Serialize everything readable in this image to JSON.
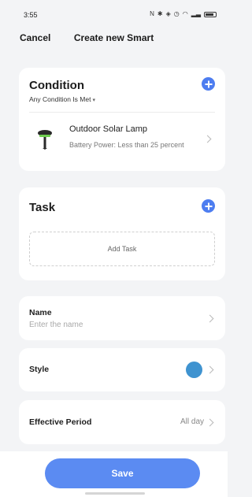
{
  "status_bar": {
    "time": "3:55",
    "icons": [
      "nfc-icon",
      "bluetooth-icon",
      "vibrate-icon",
      "alarm-icon",
      "wifi-icon",
      "signal-icon",
      "battery-icon"
    ]
  },
  "header": {
    "cancel_label": "Cancel",
    "title": "Create new Smart"
  },
  "condition": {
    "title": "Condition",
    "mode": "Any Condition Is Met",
    "caret": "▾",
    "device": {
      "name": "Outdoor Solar Lamp",
      "detail": "Battery Power: Less than 25 percent"
    }
  },
  "task": {
    "title": "Task",
    "add_label": "Add Task"
  },
  "name_field": {
    "label": "Name",
    "placeholder": "Enter the name"
  },
  "style": {
    "label": "Style",
    "color": "#3f93d0"
  },
  "effective_period": {
    "label": "Effective Period",
    "value": "All day"
  },
  "save_label": "Save",
  "colors": {
    "accent": "#4d7df0",
    "save_button": "#5b8bf2",
    "background": "#f3f4f6"
  }
}
